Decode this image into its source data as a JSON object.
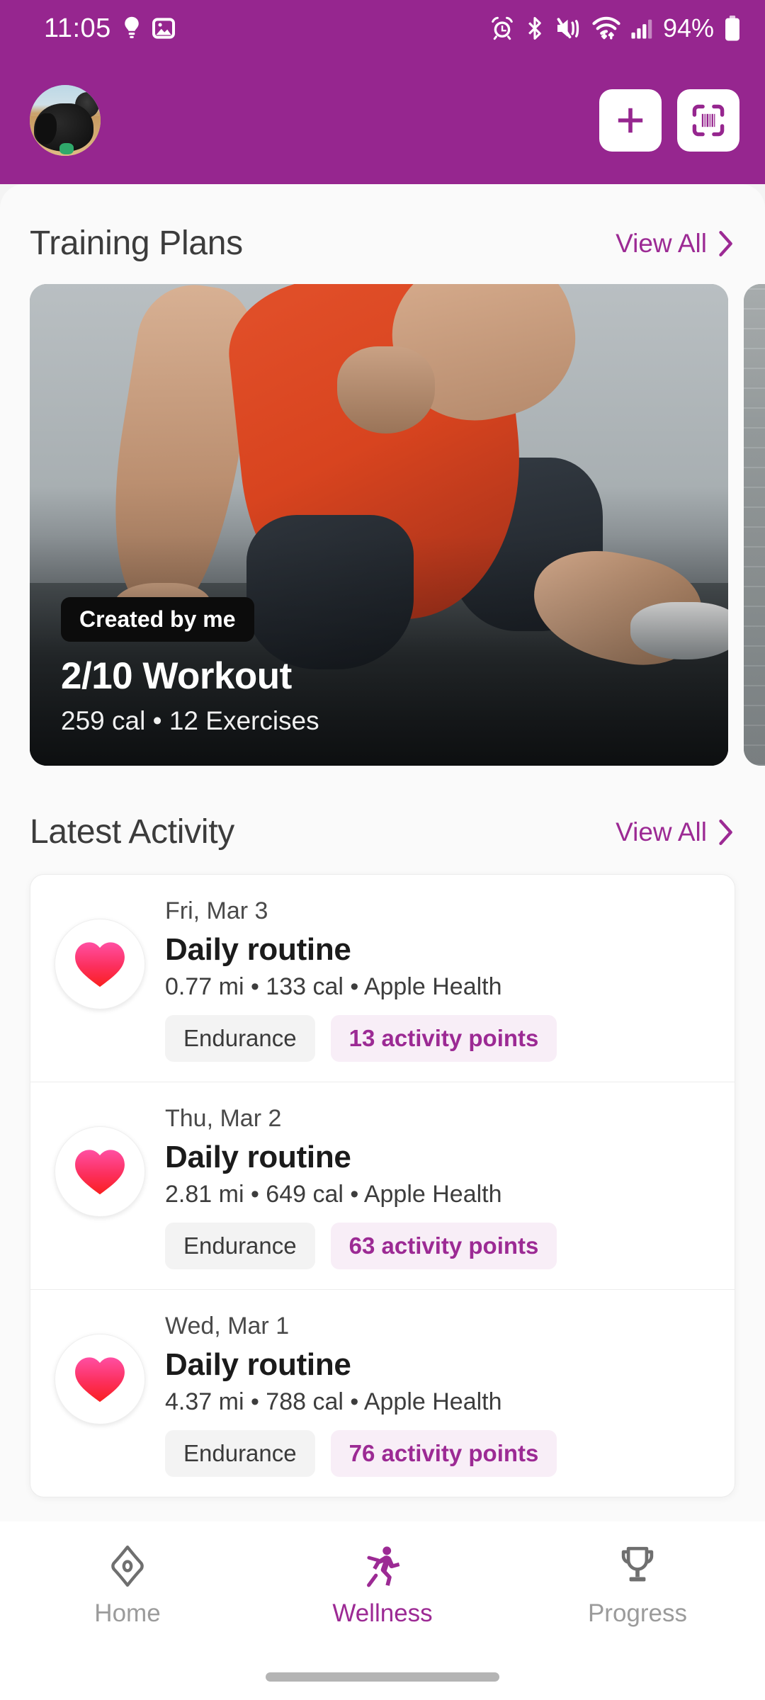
{
  "status_bar": {
    "time": "11:05",
    "battery_percent": "94%",
    "left_icons": [
      "bulb-icon",
      "image-icon"
    ],
    "right_icons": [
      "alarm-icon",
      "bluetooth-icon",
      "vibrate-mute-icon",
      "wifi-icon",
      "signal-icon",
      "battery-icon"
    ]
  },
  "header": {
    "avatar_alt": "user-avatar-dog-photo",
    "add_button": "add-icon",
    "scan_button": "barcode-scan-icon",
    "background_color": "#96268F"
  },
  "training_plans": {
    "title": "Training Plans",
    "view_all": "View All",
    "cards": [
      {
        "badge": "Created by me",
        "title": "2/10 Workout",
        "meta": "259 cal • 12 Exercises"
      }
    ]
  },
  "latest_activity": {
    "title": "Latest Activity",
    "view_all": "View All",
    "items": [
      {
        "date": "Fri, Mar 3",
        "name": "Daily routine",
        "stats": "0.77 mi  • 133 cal • Apple Health",
        "tag": "Endurance",
        "points": "13 activity points",
        "icon": "heart-icon"
      },
      {
        "date": "Thu, Mar 2",
        "name": "Daily routine",
        "stats": "2.81 mi  • 649 cal • Apple Health",
        "tag": "Endurance",
        "points": "63 activity points",
        "icon": "heart-icon"
      },
      {
        "date": "Wed, Mar 1",
        "name": "Daily routine",
        "stats": "4.37 mi  • 788 cal • Apple Health",
        "tag": "Endurance",
        "points": "76 activity points",
        "icon": "heart-icon"
      }
    ]
  },
  "bottom_nav": {
    "items": [
      {
        "label": "Home",
        "icon": "home-diamond-icon",
        "active": false
      },
      {
        "label": "Wellness",
        "icon": "running-person-icon",
        "active": true
      },
      {
        "label": "Progress",
        "icon": "trophy-icon",
        "active": false
      }
    ]
  },
  "colors": {
    "brand_purple": "#96268F",
    "accent_purple": "#9C2A94",
    "chip_points_bg": "#F8EEF7",
    "chip_tag_bg": "#F3F3F3",
    "sheet_bg": "#FAFAFA"
  }
}
